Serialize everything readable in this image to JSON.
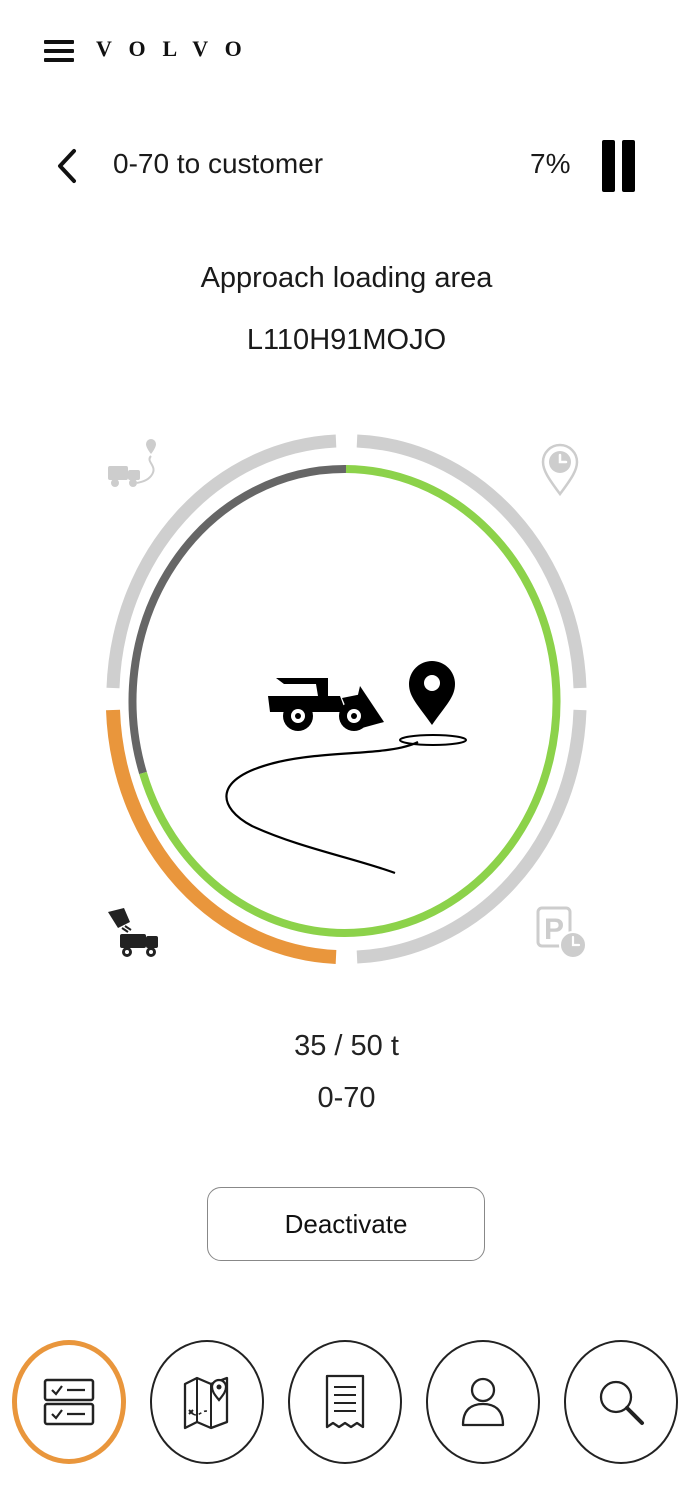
{
  "header": {
    "brand": "VOLVO",
    "menu_icon": "hamburger-menu-icon"
  },
  "trip": {
    "title": "0-70 to customer",
    "progress_label": "7%",
    "progress": 0.07
  },
  "status": {
    "step": "Approach loading area",
    "vehicle_id": "L110H91MOJO"
  },
  "cycle_ring": {
    "colors": {
      "active": "#8cd24a",
      "load": "#e9963c",
      "idle": "#cfcfcf",
      "track": "#666666"
    },
    "segments": [
      "transport-to-customer",
      "waiting-at-site",
      "parked",
      "loading"
    ],
    "icons": [
      "truck-route-icon",
      "location-clock-icon",
      "parking-clock-icon",
      "loading-truck-icon"
    ],
    "center_icons": [
      "wheel-loader-icon",
      "location-pin-icon"
    ]
  },
  "load": {
    "weight": "35 / 50 t",
    "material": "0-70"
  },
  "actions": {
    "deactivate_label": "Deactivate"
  },
  "bottom_nav": {
    "items": [
      {
        "name": "checklist",
        "icon": "checklist-icon",
        "active": true
      },
      {
        "name": "map",
        "icon": "map-pin-icon",
        "active": false
      },
      {
        "name": "receipt",
        "icon": "receipt-icon",
        "active": false
      },
      {
        "name": "profile",
        "icon": "user-icon",
        "active": false
      },
      {
        "name": "search",
        "icon": "search-icon",
        "active": false
      }
    ],
    "active_color": "#e9963c"
  }
}
